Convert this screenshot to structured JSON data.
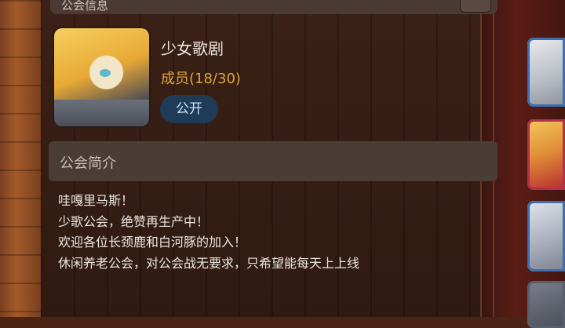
{
  "header": {
    "title": "公会信息"
  },
  "guild": {
    "name": "少女歌剧",
    "members": "成员(18/30)",
    "visibility": "公开"
  },
  "intro": {
    "label": "公会简介",
    "lines": [
      "哇嘎里马斯！",
      "少歌公会，绝赞再生产中！",
      "欢迎各位长颈鹿和白河豚的加入！",
      "休闲养老公会，对公会战无要求，只希望能每天上上线"
    ]
  },
  "colors": {
    "member_count": "#e0a53c",
    "badge_bg": "#1f3b57",
    "panel_bg": "#4a3d36"
  }
}
